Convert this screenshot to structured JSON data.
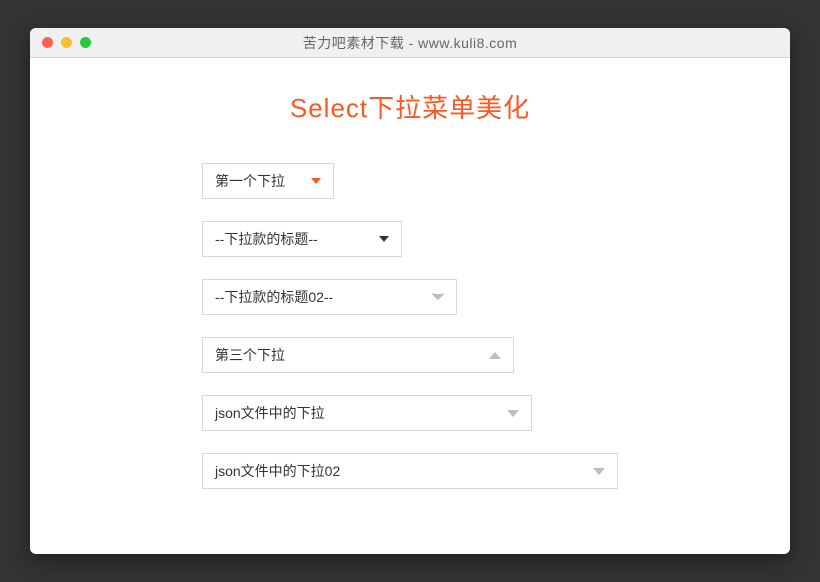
{
  "window": {
    "title": "苦力吧素材下载 - www.kuli8.com"
  },
  "page": {
    "heading": "Select下拉菜单美化"
  },
  "selects": [
    {
      "value": "第一个下拉",
      "arrow": "down-solid",
      "arrowColor": "#ff5722"
    },
    {
      "value": "--下拉款的标题--",
      "arrow": "down-solid",
      "arrowColor": "#333333"
    },
    {
      "value": "--下拉款的标题02--",
      "arrow": "chevron-down",
      "arrowColor": "#bdbdbd"
    },
    {
      "value": "第三个下拉",
      "arrow": "up-solid",
      "arrowColor": "#bdbdbd"
    },
    {
      "value": "json文件中的下拉",
      "arrow": "down-solid",
      "arrowColor": "#bdbdbd"
    },
    {
      "value": "json文件中的下拉02",
      "arrow": "down-solid",
      "arrowColor": "#bdbdbd"
    }
  ]
}
